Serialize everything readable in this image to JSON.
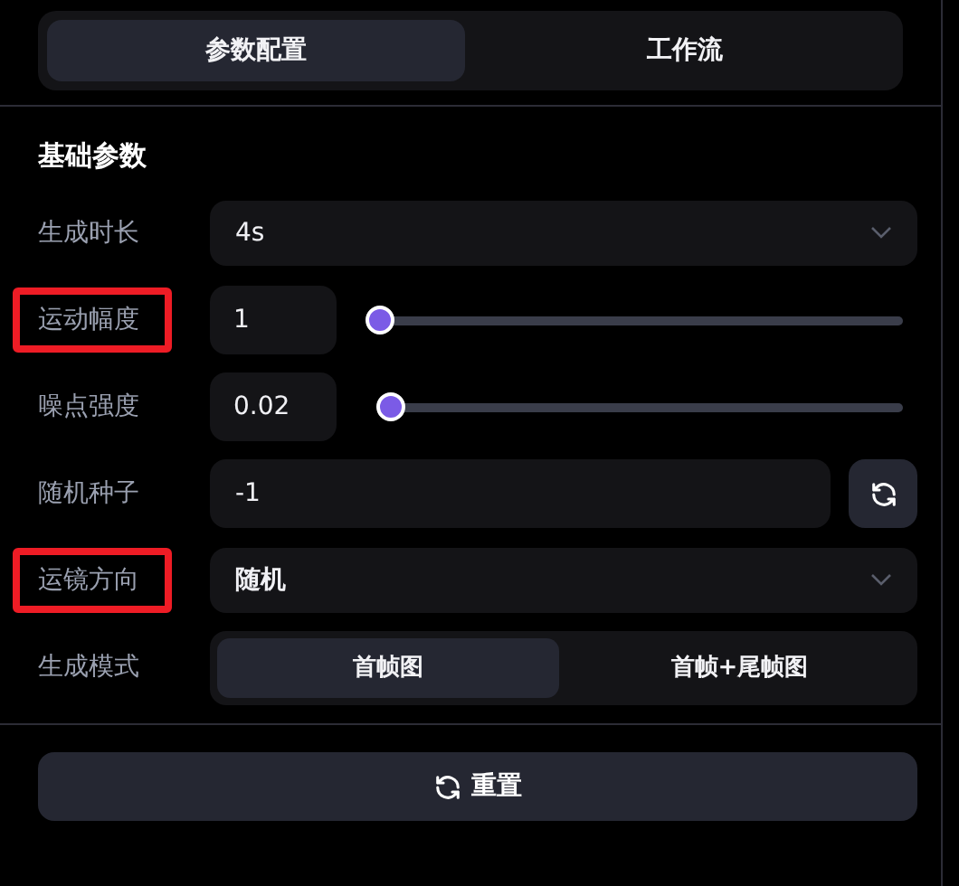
{
  "tabs": [
    {
      "label": "参数配置",
      "selected": true
    },
    {
      "label": "工作流",
      "selected": false
    }
  ],
  "section_title": "基础参数",
  "fields": [
    {
      "kind": "select",
      "label": "生成时长",
      "highlighted": false,
      "value": "4s"
    },
    {
      "kind": "slider",
      "label": "运动幅度",
      "highlighted": true,
      "value": "1",
      "level": 0
    },
    {
      "kind": "slider",
      "label": "噪点强度",
      "highlighted": false,
      "value": "0.02",
      "level": 0.02
    },
    {
      "kind": "seed",
      "label": "随机种子",
      "highlighted": false,
      "value": "-1"
    },
    {
      "kind": "select",
      "label": "运镜方向",
      "highlighted": true,
      "value": "随机"
    },
    {
      "kind": "segmented",
      "label": "生成模式",
      "highlighted": false,
      "options": [
        {
          "label": "首帧图",
          "selected": true
        },
        {
          "label": "首帧+尾帧图",
          "selected": false
        }
      ]
    }
  ],
  "reset_button": "重置"
}
